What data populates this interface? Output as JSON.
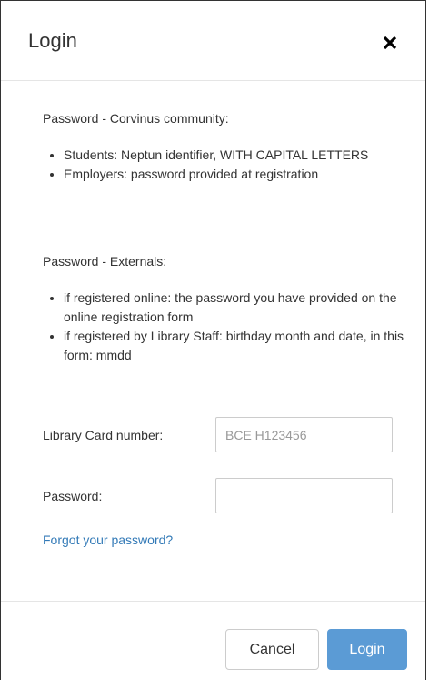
{
  "dialog": {
    "title": "Login",
    "close_icon": "close-x-icon"
  },
  "info": {
    "corvinus_heading": "Password - Corvinus community:",
    "corvinus_items": [
      "Students: Neptun identifier, WITH CAPITAL LETTERS",
      "Employers: password provided at registration"
    ],
    "externals_heading": "Password - Externals:",
    "externals_items": [
      "if registered online: the password you have provided on the online registration form",
      "if registered by Library Staff: birthday month and date, in this form: mmdd"
    ]
  },
  "form": {
    "card_label": "Library Card number:",
    "card_placeholder": "BCE H123456",
    "card_value": "",
    "password_label": "Password:",
    "password_value": "",
    "forgot_link": "Forgot your password?"
  },
  "footer": {
    "cancel_label": "Cancel",
    "login_label": "Login"
  },
  "colors": {
    "primary": "#5b9bd5",
    "link": "#337ab7",
    "text": "#333333"
  }
}
